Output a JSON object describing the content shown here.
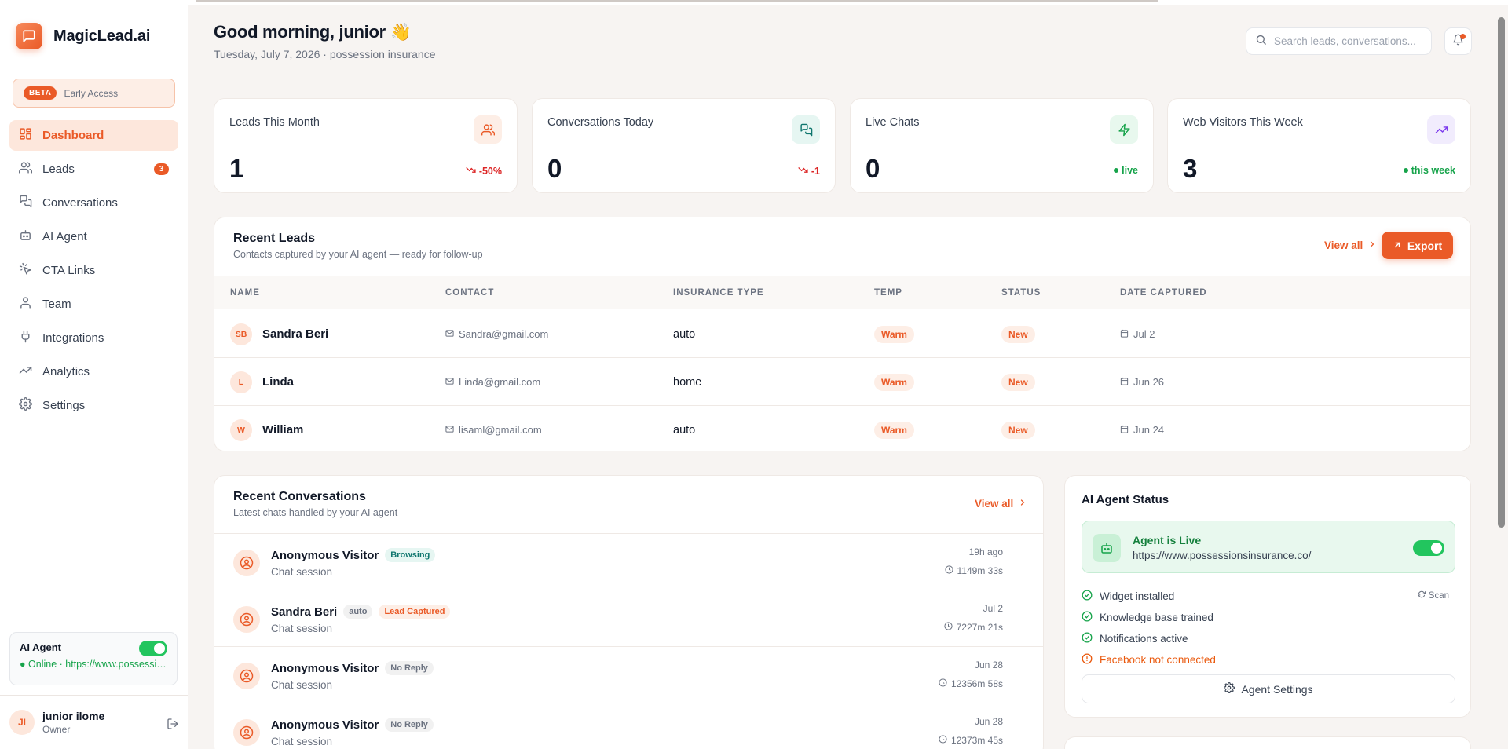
{
  "brand": {
    "name": "MagicLead.ai"
  },
  "beta": {
    "badge": "BETA",
    "text": "Early Access"
  },
  "nav": [
    {
      "label": "Dashboard",
      "icon": "grid-icon",
      "active": true
    },
    {
      "label": "Leads",
      "icon": "users-icon",
      "count": "3"
    },
    {
      "label": "Conversations",
      "icon": "chat-icon"
    },
    {
      "label": "AI Agent",
      "icon": "bot-icon"
    },
    {
      "label": "CTA Links",
      "icon": "click-icon"
    },
    {
      "label": "Team",
      "icon": "user-icon"
    },
    {
      "label": "Integrations",
      "icon": "plug-icon"
    },
    {
      "label": "Analytics",
      "icon": "trend-icon"
    },
    {
      "label": "Settings",
      "icon": "gear-icon"
    }
  ],
  "sidebar_agent": {
    "title": "AI Agent",
    "status": "Online · https://www.possessionsinsurance.co/"
  },
  "user": {
    "initials": "JI",
    "name": "junior ilome",
    "role": "Owner"
  },
  "header": {
    "greeting": "Good morning, junior 👋",
    "subline": "Tuesday, July 7, 2026 · possession insurance",
    "search_placeholder": "Search leads, conversations..."
  },
  "stats": [
    {
      "label": "Leads This Month",
      "value": "1",
      "delta": "-50%",
      "delta_type": "neg",
      "icon": "users-icon",
      "icon_bg": "#fdeee6",
      "icon_color": "#ea5a27"
    },
    {
      "label": "Conversations Today",
      "value": "0",
      "delta": "-1",
      "delta_type": "neg",
      "icon": "chat-icon",
      "icon_bg": "#e6f6f2",
      "icon_color": "#0f766e"
    },
    {
      "label": "Live Chats",
      "value": "0",
      "delta": "live",
      "delta_type": "pos",
      "icon": "bolt-icon",
      "icon_bg": "#e8f8ee",
      "icon_color": "#16a34a"
    },
    {
      "label": "Web Visitors This Week",
      "value": "3",
      "delta": "this week",
      "delta_type": "pos",
      "icon": "trend-up-icon",
      "icon_bg": "#f1ecfd",
      "icon_color": "#7c3aed"
    }
  ],
  "recent_leads": {
    "title": "Recent Leads",
    "subtitle": "Contacts captured by your AI agent — ready for follow-up",
    "view_all": "View all",
    "export": "Export",
    "columns": [
      "NAME",
      "CONTACT",
      "INSURANCE TYPE",
      "TEMP",
      "STATUS",
      "DATE CAPTURED"
    ],
    "rows": [
      {
        "initials": "SB",
        "name": "Sandra Beri",
        "contact": "Sandra@gmail.com",
        "type": "auto",
        "temp": "Warm",
        "status": "New",
        "date": "Jul 2"
      },
      {
        "initials": "L",
        "name": "Linda",
        "contact": "Linda@gmail.com",
        "type": "home",
        "temp": "Warm",
        "status": "New",
        "date": "Jun 26"
      },
      {
        "initials": "W",
        "name": "William",
        "contact": "lisaml@gmail.com",
        "type": "auto",
        "temp": "Warm",
        "status": "New",
        "date": "Jun 24"
      }
    ]
  },
  "recent_conversations": {
    "title": "Recent Conversations",
    "subtitle": "Latest chats handled by your AI agent",
    "view_all": "View all",
    "rows": [
      {
        "name": "Anonymous Visitor",
        "tags": [
          {
            "text": "Browsing",
            "kind": "browsing"
          }
        ],
        "sub": "Chat session",
        "time": "19h ago",
        "duration": "1149m 33s"
      },
      {
        "name": "Sandra Beri",
        "tags": [
          {
            "text": "auto",
            "kind": "grey"
          },
          {
            "text": "Lead Captured",
            "kind": "captured"
          }
        ],
        "sub": "Chat session",
        "time": "Jul 2",
        "duration": "7227m 21s"
      },
      {
        "name": "Anonymous Visitor",
        "tags": [
          {
            "text": "No Reply",
            "kind": "grey"
          }
        ],
        "sub": "Chat session",
        "time": "Jun 28",
        "duration": "12356m 58s"
      },
      {
        "name": "Anonymous Visitor",
        "tags": [
          {
            "text": "No Reply",
            "kind": "grey"
          }
        ],
        "sub": "Chat session",
        "time": "Jun 28",
        "duration": "12373m 45s"
      }
    ]
  },
  "agent_status": {
    "title": "AI Agent Status",
    "live_title": "Agent is Live",
    "live_url": "https://www.possessionsinsurance.co/",
    "checks": [
      {
        "text": "Widget installed",
        "ok": true
      },
      {
        "text": "Knowledge base trained",
        "ok": true
      },
      {
        "text": "Notifications active",
        "ok": true
      },
      {
        "text": "Facebook not connected",
        "ok": false
      }
    ],
    "scan": "Scan",
    "settings_button": "Agent Settings"
  }
}
